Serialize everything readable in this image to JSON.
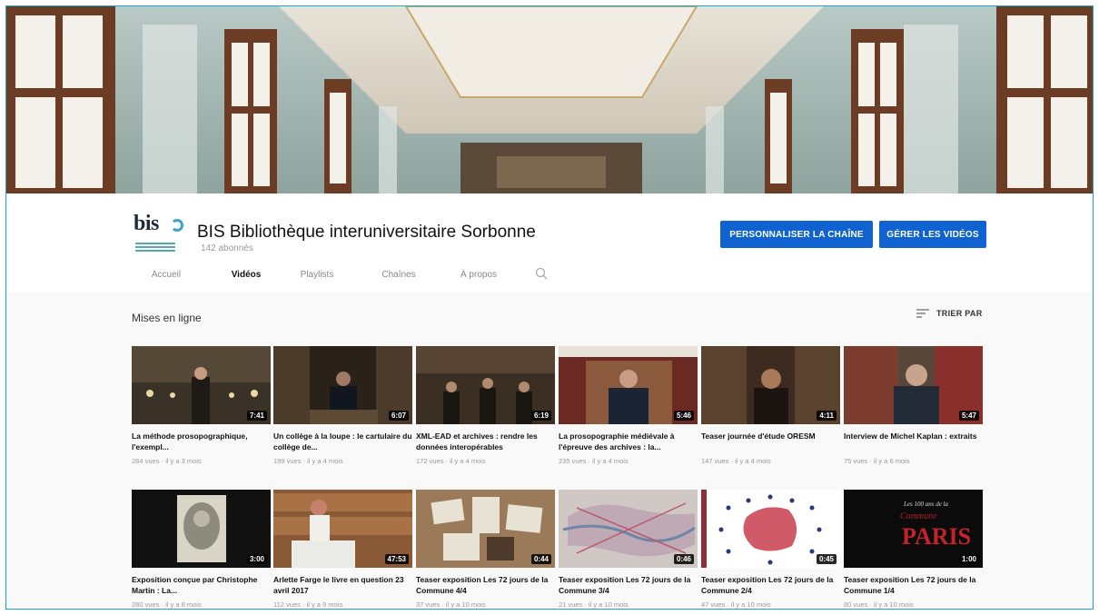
{
  "channel": {
    "name": "BIS Bibliothèque interuniversitaire Sorbonne",
    "subscribers": "142 abonnés",
    "logo_text": "bis",
    "buttons": {
      "customize": "PERSONNALISER LA CHAÎNE",
      "manage": "GÉRER LES VIDÉOS"
    }
  },
  "tabs": [
    {
      "label": "Accueil"
    },
    {
      "label": "Vidéos"
    },
    {
      "label": "Playlists"
    },
    {
      "label": "Chaînes"
    },
    {
      "label": "À propos"
    }
  ],
  "section": {
    "title": "Mises en ligne",
    "sort_label": "TRIER PAR"
  },
  "videos": [
    {
      "title": "La méthode prosopographique, l'exempl...",
      "meta": "284 vues · il y a 3 mois",
      "duration": "7:41"
    },
    {
      "title": "Un collège à la loupe : le cartulaire du collège de...",
      "meta": "199 vues · il y a 4 mois",
      "duration": "6:07"
    },
    {
      "title": "XML-EAD et archives : rendre les données interopérables",
      "meta": "172 vues · il y a 4 mois",
      "duration": "6:19"
    },
    {
      "title": "La prosopographie médiévale à l'épreuve des archives : la...",
      "meta": "235 vues · il y a 4 mois",
      "duration": "5:46"
    },
    {
      "title": "Teaser journée d'étude ORESM",
      "meta": "147 vues · il y a 4 mois",
      "duration": "4:11"
    },
    {
      "title": "Interview de Michel Kaplan : extraits",
      "meta": "75 vues · il y a 6 mois",
      "duration": "5:47"
    },
    {
      "title": "Exposition conçue par Christophe Martin : La...",
      "meta": "280 vues · il y a 6 mois",
      "duration": "3:00"
    },
    {
      "title": "Arlette Farge le livre en question 23 avril 2017",
      "meta": "112 vues · il y a 9 mois",
      "duration": "47:53"
    },
    {
      "title": "Teaser exposition Les 72 jours de la Commune 4/4",
      "meta": "37 vues · il y a 10 mois",
      "duration": "0:44"
    },
    {
      "title": "Teaser exposition Les 72 jours de la Commune 3/4",
      "meta": "21 vues · il y a 10 mois",
      "duration": "0:46"
    },
    {
      "title": "Teaser exposition Les 72 jours de la Commune 2/4",
      "meta": "47 vues · il y a 10 mois",
      "duration": "0:45"
    },
    {
      "title": "Teaser exposition Les 72 jours de la Commune 1/4",
      "meta": "80 vues · il y a 10 mois",
      "duration": "1:00"
    }
  ],
  "thumb_overlay_text": {
    "line1": "Les 100 ans de la",
    "line2": "Commune",
    "line3": "PARIS"
  },
  "colors": {
    "accent": "#0f62d0",
    "frame": "#1aa7c4"
  }
}
